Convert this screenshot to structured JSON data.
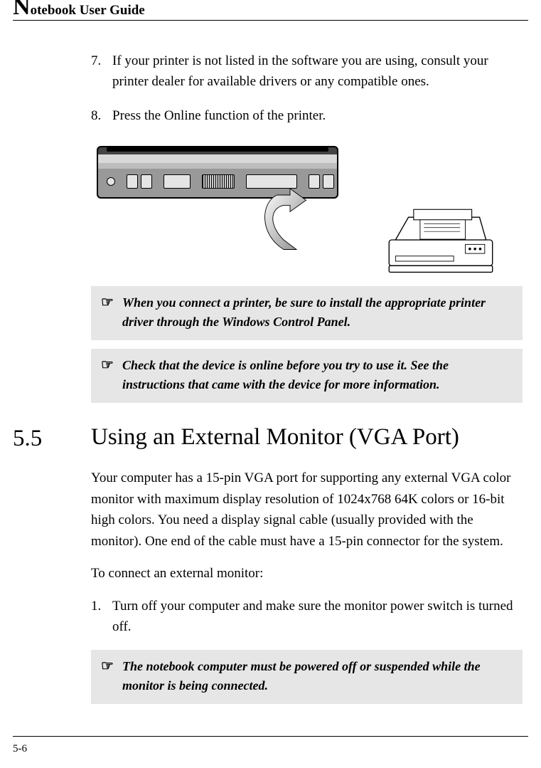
{
  "header": {
    "dropcap": "N",
    "title_rest": "otebook User Guide"
  },
  "list": {
    "item7_num": "7.",
    "item7_text": "If your printer is not listed in the software you are using, consult your printer dealer for available drivers or any compatible ones.",
    "item8_num": "8.",
    "item8_text": "Press the Online function of the printer."
  },
  "notes": {
    "pointer": "☞",
    "note1": "When you connect a printer, be sure to install the appropriate printer driver through the Windows Control Panel.",
    "note2": "Check that the device is online before you try to use it. See the instructions that came with the device for more information.",
    "note3": "The notebook computer must be powered off or suspended while the monitor is being connected."
  },
  "section": {
    "number": "5.5",
    "title": "Using an External Monitor (VGA Port)"
  },
  "body": {
    "para1": "Your computer has a 15-pin VGA port for supporting any external VGA color monitor with maximum display resolution of 1024x768 64K colors or 16-bit high colors. You need a display signal cable (usually provided with the monitor). One end of the cable must have a 15-pin connector for the system.",
    "para2": "To connect an external monitor:",
    "step1_num": "1.",
    "step1_text": "Turn off your computer and make sure the monitor power switch is turned off."
  },
  "footer": {
    "page": "5-6"
  },
  "figure": {
    "name": "laptop-to-printer-diagram"
  }
}
